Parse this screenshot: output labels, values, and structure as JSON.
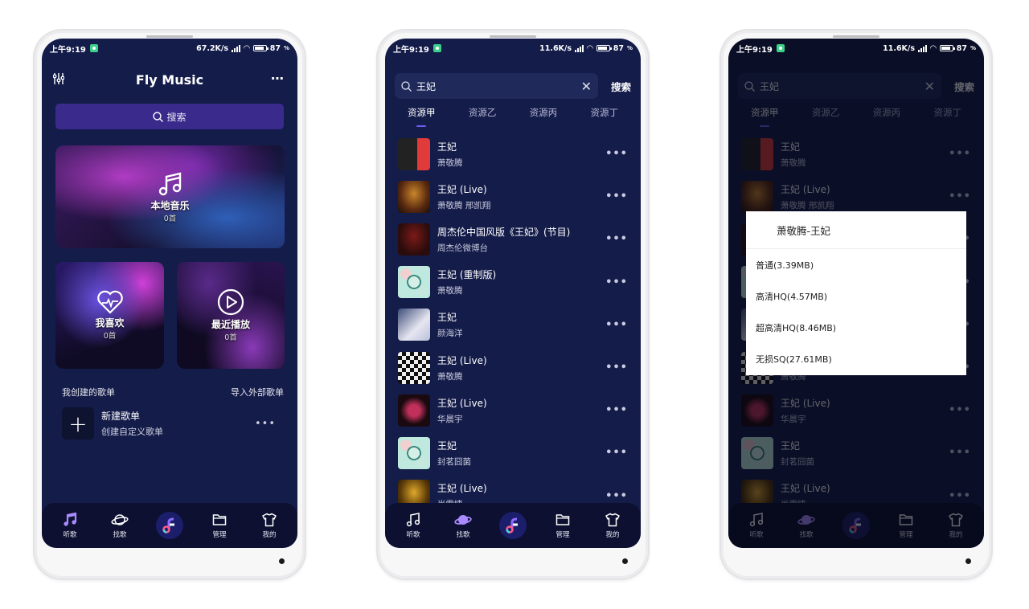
{
  "status_bar": {
    "time": "上午9:19",
    "battery": "87",
    "screens": [
      {
        "speed": "67.2K/s"
      },
      {
        "speed": "11.6K/s"
      },
      {
        "speed": "11.6K/s"
      }
    ]
  },
  "home": {
    "title": "Fly Music",
    "more_icon": "⋯",
    "search_label": "搜索",
    "cards": {
      "local": {
        "label": "本地音乐",
        "count": "0首"
      },
      "like": {
        "label": "我喜欢",
        "count": "0首"
      },
      "recent": {
        "label": "最近播放",
        "count": "0首"
      }
    },
    "my_playlists_label": "我创建的歌单",
    "import_label": "导入外部歌单",
    "new_playlist": {
      "title": "新建歌单",
      "subtitle": "创建自定义歌单"
    }
  },
  "search": {
    "query": "王妃",
    "button_label": "搜索",
    "tabs": [
      {
        "label": "资源甲",
        "active": true
      },
      {
        "label": "资源乙",
        "active": false
      },
      {
        "label": "资源丙",
        "active": false
      },
      {
        "label": "资源丁",
        "active": false
      }
    ],
    "results": [
      {
        "title": "王妃",
        "artist": "萧敬腾"
      },
      {
        "title": "王妃 (Live)",
        "artist": "萧敬腾  邢凯翔"
      },
      {
        "title": "周杰伦中国风版《王妃》(节目)",
        "artist": "周杰伦微博台"
      },
      {
        "title": "王妃 (重制版)",
        "artist": "萧敬腾"
      },
      {
        "title": "王妃",
        "artist": "颜海洋"
      },
      {
        "title": "王妃 (Live)",
        "artist": "萧敬腾"
      },
      {
        "title": "王妃 (Live)",
        "artist": "华晨宇"
      },
      {
        "title": "王妃",
        "artist": "封茗囧菌"
      },
      {
        "title": "王妃 (Live)",
        "artist": "尚雯婕"
      }
    ]
  },
  "quality_dialog": {
    "title": "萧敬腾-王妃",
    "options": [
      "普通(3.39MB)",
      "高清HQ(4.57MB)",
      "超高清HQ(8.46MB)",
      "无损SQ(27.61MB)"
    ]
  },
  "bottom_nav": {
    "items": [
      {
        "label": "听歌",
        "icon": "music-note-icon"
      },
      {
        "label": "找歌",
        "icon": "planet-icon"
      },
      {
        "label": "",
        "icon": "app-logo-icon"
      },
      {
        "label": "管理",
        "icon": "folder-icon"
      },
      {
        "label": "我的",
        "icon": "tshirt-icon"
      }
    ]
  },
  "colors": {
    "background": "#141c4a",
    "accent": "#6e5cf2",
    "search_button": "#3a2a8c",
    "nav_bar": "#0d1030"
  }
}
